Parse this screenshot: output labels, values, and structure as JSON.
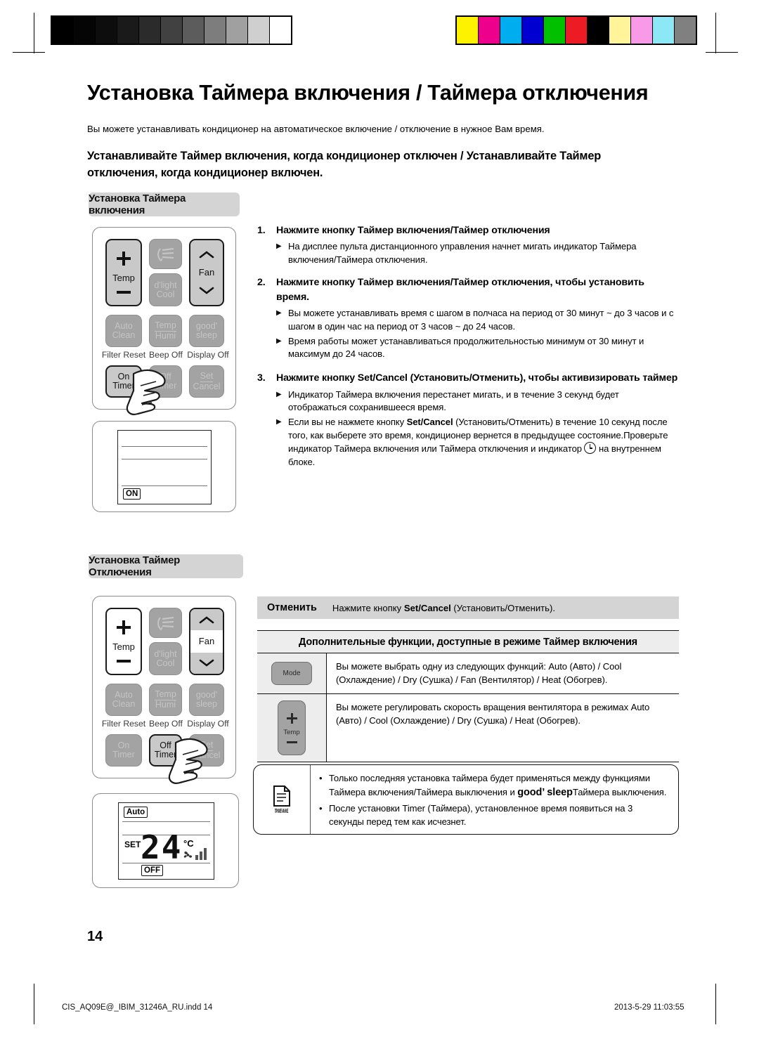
{
  "document": {
    "title": "Установка Таймера включения / Таймера отключения",
    "lead": "Вы можете устанавливать кондиционер на автоматическое включение / отключение в нужное Вам время.",
    "subhead": "Устанавливайте Таймер включения, когда кондиционер отключен / Устанавливайте Таймер отключения, когда кондиционер включен.",
    "page_number": "14"
  },
  "sections": {
    "on_timer_tab": "Установка Таймера включения",
    "off_timer_tab": "Установка Таймер Отключения"
  },
  "remote_on": {
    "buttons": {
      "temp": "Temp",
      "plus": "+",
      "minus": "−",
      "swing_icon": "swing-icon",
      "dlight": "d'light",
      "cool": "Cool",
      "fan": "Fan",
      "chevron_up": "chevron-up-icon",
      "chevron_down": "chevron-down-icon",
      "auto": "Auto",
      "clean": "Clean",
      "temp_humi_top": "Temp",
      "temp_humi_bottom": "Humi",
      "goodsleep_top": "good'",
      "goodsleep_bottom": "sleep",
      "on": "On",
      "timer": "Timer",
      "off": "Off",
      "off_timer": "Timer",
      "set": "Set",
      "cancel": "Cancel"
    },
    "captions": {
      "filter_reset": "Filter Reset",
      "beep_off": "Beep Off",
      "display_off": "Display Off"
    }
  },
  "lcd_on": {
    "indicator": "ON"
  },
  "lcd_off": {
    "mode": "Auto",
    "set_label": "SET",
    "temperature": "24",
    "unit": "°C",
    "indicator": "OFF",
    "fan_icon": "fan-icon",
    "fan_level_bars": 3
  },
  "steps": [
    {
      "num": "1.",
      "heading": "Нажмите кнопку Таймер включения/Таймер отключения",
      "bullets": [
        "На дисплее пульта дистанционного управления начнет мигать индикатор Таймера включения/Таймера отключения."
      ]
    },
    {
      "num": "2.",
      "heading": "Нажмите кнопку Таймер включения/Таймер отключения, чтобы установить время.",
      "bullets": [
        "Вы можете устанавливать время с шагом в полчаса на период от 30 минут ~ до 3 часов и с шагом в один час на период от 3 часов ~ до 24 часов.",
        "Время работы может устанавливаться продолжительностью минимум от 30 минут и максимум до 24 часов."
      ]
    },
    {
      "num": "3.",
      "heading_pre": "Нажмите кнопку ",
      "heading_key": "Set/Cancel",
      "heading_post": " (Установить/Отменить), чтобы активизировать таймер",
      "bullets": [
        "Индикатор Таймера включения перестанет мигать, и в течение 3 секунд будет отображаться сохранившееся время."
      ],
      "bullet2_pre": "Если вы не нажмете кнопку ",
      "bullet2_key": "Set/Cancel",
      "bullet2_mid": " (Установить/Отменить) в течение 10 секунд после того, как выберете это время, кондиционер вернется в предыдущее состояние.Проверьте индикатор Таймера включения или Таймера отключения и индикатор ",
      "bullet2_post": " на внутреннем блоке."
    }
  ],
  "cancel_row": {
    "label": "Отменить",
    "text_pre": "Нажмите кнопку ",
    "text_key": "Set/Cancel",
    "text_post": " (Установить/Отменить)."
  },
  "function_table": {
    "header": "Дополнительные функции, доступные в режиме Таймер включения",
    "rows": [
      {
        "icon": "mode-button-icon",
        "icon_label": "Mode",
        "text": "Вы можете выбрать одну из следующих функций: Auto (Авто) / Cool (Охлаждение) / Dry (Сушка) / Fan (Вентилятор) / Heat (Обогрев)."
      },
      {
        "icon": "temp-button-icon",
        "icon_label": "Temp",
        "text": "Вы можете регулировать скорость вращения вентилятора в режимах Auto (Авто) / Cool (Охлаждение) / Dry (Сушка) / Heat (Обогрев)."
      }
    ]
  },
  "note": {
    "label": "ПРИМЕЧАНИЕ",
    "icon": "document-note-icon",
    "items": [
      {
        "pre": "Только последняя установка таймера будет применяться между функциями Таймера включения/Таймера выключения и ",
        "key": "good’ sleep",
        "post": "Таймера выключения."
      },
      {
        "pre": "После установки Timer (Таймера), установленное время появиться на 3 секунды перед тем как исчезнет.",
        "key": "",
        "post": ""
      }
    ]
  },
  "footer": {
    "file": "CIS_AQ09E@_IBIM_31246A_RU.indd   14",
    "timestamp": "2013-5-29   11:03:55"
  },
  "print_marks": {
    "gray_bar": [
      "#000000",
      "#050505",
      "#0d0d0d",
      "#1a1a1a",
      "#2b2b2b",
      "#414141",
      "#5c5c5c",
      "#7d7d7d",
      "#a0a0a0",
      "#cfcfcf",
      "#ffffff"
    ],
    "color_bar": [
      "#fff200",
      "#ec008c",
      "#00aeef",
      "#0000d0",
      "#00c000",
      "#ed1c24",
      "#000000",
      "#fff49a",
      "#f99ae8",
      "#8ce8f5",
      "#808080"
    ]
  }
}
